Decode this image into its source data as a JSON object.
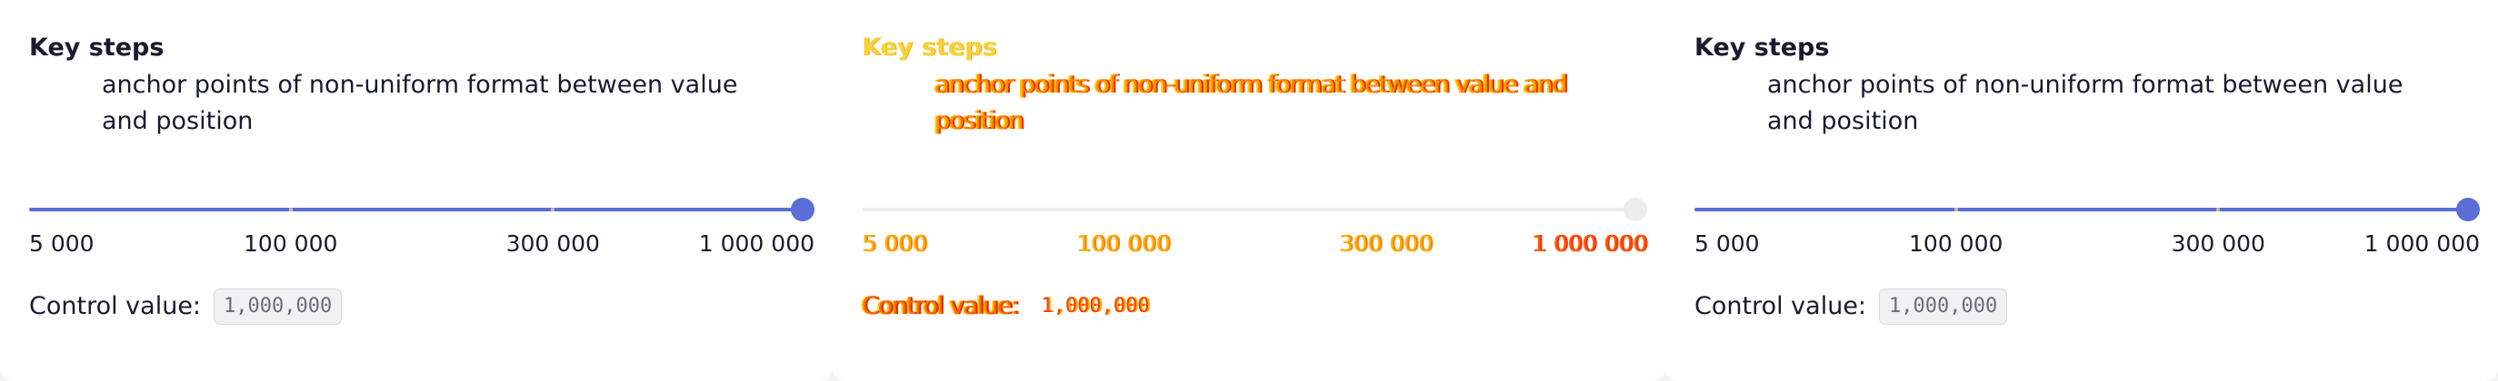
{
  "cards": [
    {
      "title": "Key steps",
      "description": "anchor points of non-uniform format between value and position",
      "slider": {
        "value_fraction": 1.0,
        "marks_fractions": [
          0.0,
          0.333,
          0.667,
          1.0
        ]
      },
      "ticks": [
        "5 000",
        "100 000",
        "300 000",
        "1 000 000"
      ],
      "control_label": "Control value:",
      "control_value": "1,000,000"
    },
    {
      "title": "Key steps",
      "description": "anchor points of non-uniform format between value and position",
      "slider": {
        "value_fraction": 1.0,
        "marks_fractions": [
          0.0,
          0.333,
          0.667,
          1.0
        ]
      },
      "ticks": [
        "5 000",
        "100 000",
        "300 000",
        "1 000 000"
      ],
      "control_label": "Control value:",
      "control_value": "1,000,000"
    },
    {
      "title": "Key steps",
      "description": "anchor points of non-uniform format between value and position",
      "slider": {
        "value_fraction": 1.0,
        "marks_fractions": [
          0.0,
          0.333,
          0.667,
          1.0
        ]
      },
      "ticks": [
        "5 000",
        "100 000",
        "300 000",
        "1 000 000"
      ],
      "control_label": "Control value:",
      "control_value": "1,000,000"
    }
  ],
  "colors": {
    "accent": "#5a6fd6",
    "text": "#1a1a2e",
    "track": "#e6e6ea",
    "glitch_orange": "#ff8a00",
    "glitch_yellow": "#f5d23a",
    "glitch_red": "#ff3a00"
  }
}
